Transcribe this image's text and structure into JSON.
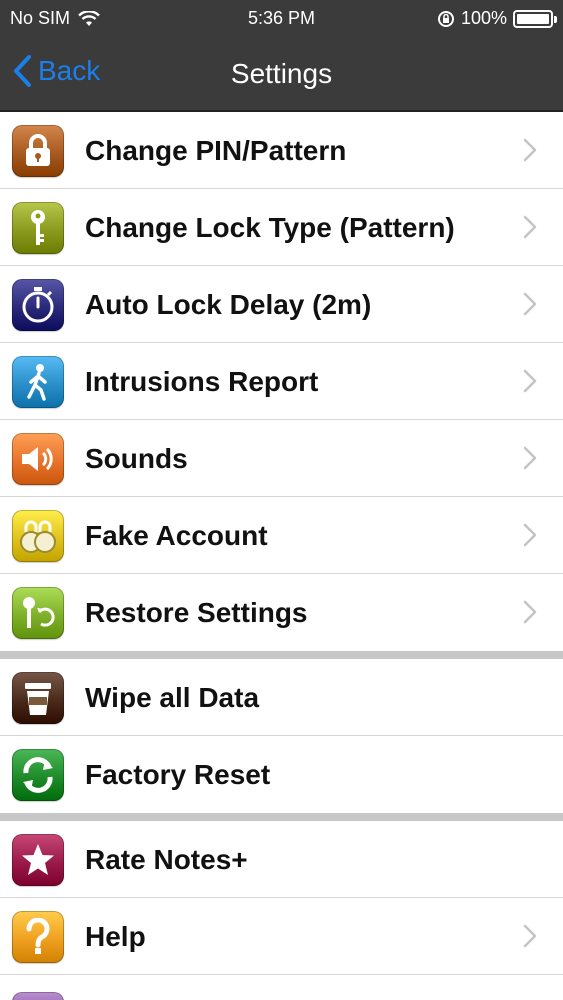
{
  "status_bar": {
    "carrier": "No SIM",
    "time": "5:36 PM",
    "battery": "100%",
    "battery_level": 1.0
  },
  "nav": {
    "back_label": "Back",
    "title": "Settings",
    "accent": "#1a7fe8"
  },
  "sections": [
    {
      "items": [
        {
          "label": "Change PIN/Pattern",
          "icon": "lock-icon",
          "color": "#a65a1f",
          "chevron": true
        },
        {
          "label": "Change Lock Type (Pattern)",
          "icon": "key-icon",
          "color": "#8a9a1e",
          "chevron": true
        },
        {
          "label": "Auto Lock Delay (2m)",
          "icon": "stopwatch-icon",
          "color": "#2b2a7a",
          "chevron": true
        },
        {
          "label": "Intrusions Report",
          "icon": "walking-person-icon",
          "color": "#2a8fc8",
          "chevron": true
        },
        {
          "label": "Sounds",
          "icon": "speaker-icon",
          "color": "#e8732a",
          "chevron": true
        },
        {
          "label": "Fake Account",
          "icon": "coins-lock-icon",
          "color": "#e0c21e",
          "chevron": true
        },
        {
          "label": "Restore Settings",
          "icon": "key-refresh-icon",
          "color": "#7fb02a",
          "chevron": true
        }
      ]
    },
    {
      "items": [
        {
          "label": "Wipe all Data",
          "icon": "trash-cup-icon",
          "color": "#4a2a1a",
          "chevron": false
        },
        {
          "label": "Factory Reset",
          "icon": "refresh-icon",
          "color": "#1f8a2a",
          "chevron": false
        }
      ]
    },
    {
      "items": [
        {
          "label": "Rate Notes+",
          "icon": "star-icon",
          "color": "#9a1a4a",
          "chevron": false
        },
        {
          "label": "Help",
          "icon": "question-icon",
          "color": "#f0a020",
          "chevron": true
        }
      ]
    }
  ]
}
